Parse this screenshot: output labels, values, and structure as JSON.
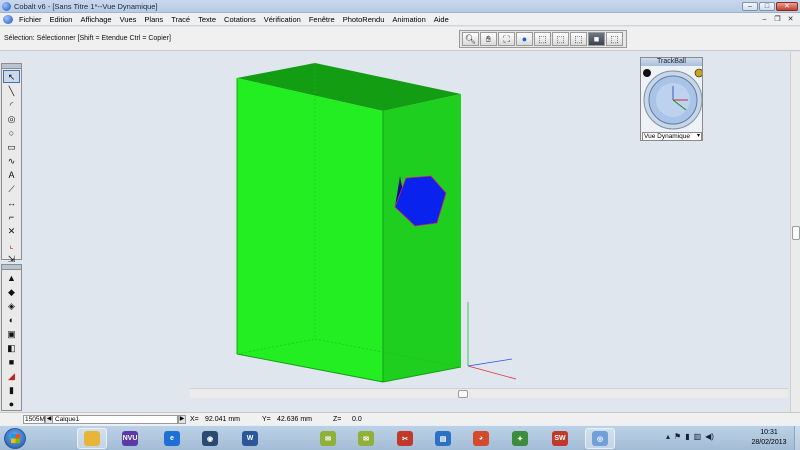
{
  "window": {
    "title": "Cobalt v6 - [Sans Titre 1*--Vue Dynamique]",
    "controls": [
      "–",
      "□",
      "✕"
    ]
  },
  "menubar": {
    "items": [
      "Fichier",
      "Edition",
      "Affichage",
      "Vues",
      "Plans",
      "Tracé",
      "Texte",
      "Cotations",
      "Vérification",
      "Fenêtre",
      "PhotoRendu",
      "Animation",
      "Aide"
    ],
    "mdi_controls": [
      "–",
      "❐",
      "✕"
    ]
  },
  "optionbar": {
    "selection_text": "Sélection: Sélectionner  [Shift = Etendue Ctrl = Copier]"
  },
  "view_toolbar": {
    "buttons": [
      {
        "icon": "zoom-icon",
        "glyph": "🔍︎"
      },
      {
        "icon": "pan-hand-icon",
        "glyph": "✋︎"
      },
      {
        "icon": "walk-icon",
        "glyph": "⛶"
      },
      {
        "icon": "globe-icon",
        "glyph": "●"
      },
      {
        "icon": "cube-front-icon",
        "glyph": "⬚"
      },
      {
        "icon": "cube-side-icon",
        "glyph": "⬚"
      },
      {
        "icon": "cube-top-icon",
        "glyph": "⬚"
      },
      {
        "icon": "cube-shaded-icon",
        "glyph": "■"
      },
      {
        "icon": "cube-iso-icon",
        "glyph": "⬚"
      }
    ]
  },
  "left_toolbar_1": {
    "tools": [
      {
        "icon": "select-arrow-icon",
        "glyph": "↖"
      },
      {
        "icon": "line-icon",
        "glyph": "╲"
      },
      {
        "icon": "arc-icon",
        "glyph": "◜"
      },
      {
        "icon": "circle-center-icon",
        "glyph": "◎"
      },
      {
        "icon": "circle-icon",
        "glyph": "○"
      },
      {
        "icon": "rectangle-icon",
        "glyph": "▭"
      },
      {
        "icon": "spline-icon",
        "glyph": "∿"
      },
      {
        "icon": "text-icon",
        "glyph": "A"
      },
      {
        "icon": "dimension-icon",
        "glyph": "⟋"
      },
      {
        "icon": "measure-icon",
        "glyph": "↔"
      },
      {
        "icon": "trim-icon",
        "glyph": "⌐"
      },
      {
        "icon": "extend-icon",
        "glyph": "✕"
      },
      {
        "icon": "fillet-icon",
        "glyph": "⌞"
      },
      {
        "icon": "transform-icon",
        "glyph": "⇲"
      }
    ]
  },
  "left_toolbar_2": {
    "tools": [
      {
        "icon": "extrude-icon",
        "glyph": "▲"
      },
      {
        "icon": "sweep-icon",
        "glyph": "◆"
      },
      {
        "icon": "loft-icon",
        "glyph": "◈"
      },
      {
        "icon": "revolve-icon",
        "glyph": "◐"
      },
      {
        "icon": "shell-icon",
        "glyph": "▣"
      },
      {
        "icon": "boolean-icon",
        "glyph": "◧"
      },
      {
        "icon": "box-icon",
        "glyph": "■"
      },
      {
        "icon": "chamfer-icon",
        "glyph": "◢"
      },
      {
        "icon": "cylinder-icon",
        "glyph": "▮"
      },
      {
        "icon": "sphere-icon",
        "glyph": "●"
      }
    ]
  },
  "trackball": {
    "title": "TrackBall",
    "mode": "Vue Dynamique"
  },
  "statusbar": {
    "zoom": "1505M",
    "layer": "Calque1",
    "x_label": "X=",
    "x_value": "92.041 mm",
    "y_label": "Y=",
    "y_value": "42.636 mm",
    "z_label": "Z=",
    "z_value": "0.0"
  },
  "taskbar": {
    "apps": [
      {
        "name": "explorer",
        "label": "",
        "color": "#e8b43a"
      },
      {
        "name": "nvu",
        "label": "NVU",
        "color": "#5b3aa8"
      },
      {
        "name": "internet-explorer",
        "label": "e",
        "color": "#1e6fd6"
      },
      {
        "name": "media",
        "label": "◉",
        "color": "#2a4a73"
      },
      {
        "name": "word",
        "label": "W",
        "color": "#2b579a"
      },
      {
        "name": "chat",
        "label": "✉",
        "color": "#8fb13a"
      },
      {
        "name": "chat-2",
        "label": "✉",
        "color": "#8fb13a"
      },
      {
        "name": "tools",
        "label": "✂",
        "color": "#c0392b"
      },
      {
        "name": "remote-desktop",
        "label": "▤",
        "color": "#2b72c6"
      },
      {
        "name": "chrome",
        "label": "◕",
        "color": "#d44a2c"
      },
      {
        "name": "network",
        "label": "✦",
        "color": "#3c8c3c"
      },
      {
        "name": "solidworks",
        "label": "SW",
        "color": "#c0392b"
      },
      {
        "name": "cobalt",
        "label": "◎",
        "color": "#6fa0d8"
      }
    ],
    "tray_icons": [
      "▴",
      "⚑",
      "▮",
      "▥",
      "◀)"
    ],
    "time": "10:31",
    "date": "28/02/2013"
  }
}
